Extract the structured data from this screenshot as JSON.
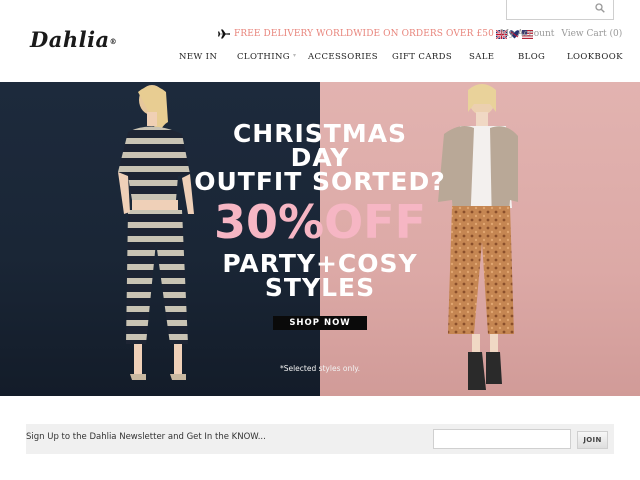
{
  "brand": {
    "logo_text": "Dahlia",
    "reg_mark": "®"
  },
  "search": {
    "placeholder": ""
  },
  "promo": {
    "text": "FREE DELIVERY WORLDWIDE ON ORDERS OVER £50",
    "color": "#e8857c",
    "icons": [
      "plane-icon",
      "uk-flag-icon",
      "heart-flag-icon",
      "us-flag-icon"
    ]
  },
  "account": {
    "my_account": "My Account",
    "view_cart": "View Cart (0)"
  },
  "nav": {
    "items": [
      {
        "label": "NEW IN"
      },
      {
        "label": "CLOTHING",
        "has_dropdown": true
      },
      {
        "label": "ACCESSORIES"
      },
      {
        "label": "GIFT CARDS"
      },
      {
        "label": "SALE"
      },
      {
        "label": "BLOG"
      },
      {
        "label": "LOOKBOOK"
      }
    ]
  },
  "hero": {
    "line1": "CHRISTMAS",
    "line2": "DAY",
    "line3": "OUTFIT SORTED?",
    "discount": "30%OFF",
    "line5": "PARTY+COSY",
    "line6": "STYLES",
    "cta": "SHOP NOW",
    "disclaimer": "*Selected styles only.",
    "colors": {
      "left_bg": "#1a2636",
      "right_bg": "#dca9a6",
      "discount": "#f6b6c4"
    }
  },
  "newsletter": {
    "label": "Sign Up to the Dahlia Newsletter and Get In the KNOW...",
    "input_value": "",
    "button": "JOIN"
  }
}
